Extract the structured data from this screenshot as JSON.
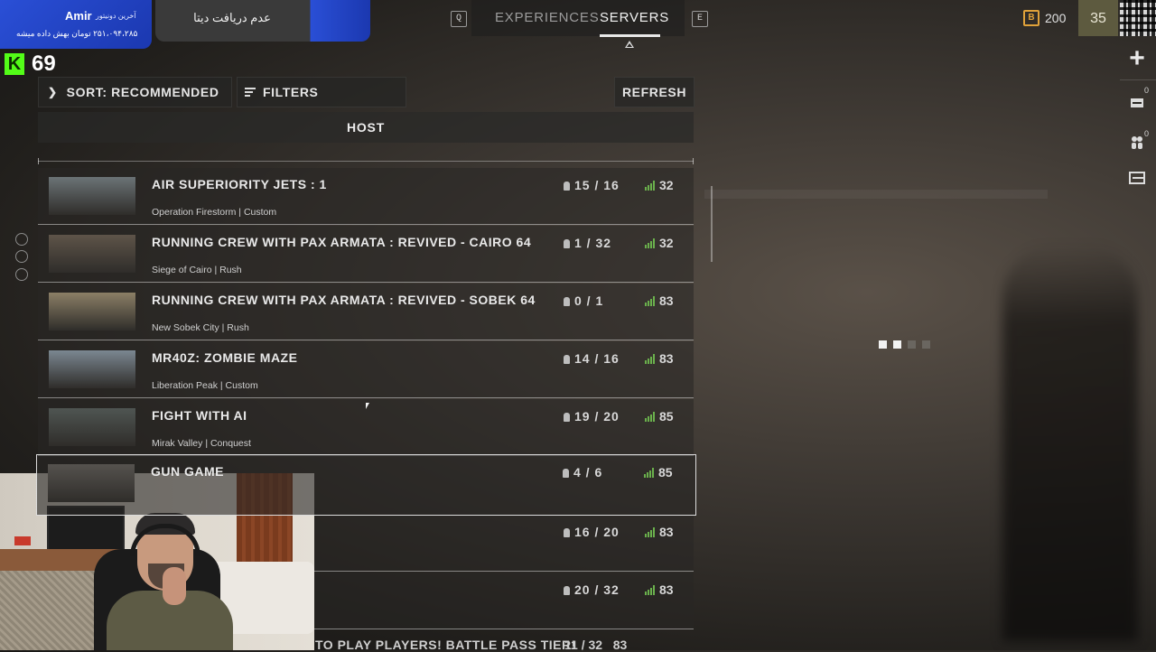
{
  "top_nav": {
    "key_left": "Q",
    "key_right": "E",
    "tabs": [
      {
        "label": "EXPERIENCES",
        "active": false
      },
      {
        "label": "SERVERS",
        "active": true
      }
    ],
    "currency_amount": "200",
    "player_level": "35"
  },
  "stream_overlay": {
    "donor_name": "Amir",
    "donor_caption": "آخرین دونیتور",
    "donation_text": "۲۵۱،۰۹۴،۲۸۵ تومان بهش داده میشه",
    "status_text": "عدم دریافت دیتا",
    "viewer_count": "69"
  },
  "side_panel": {
    "count_top": "0",
    "count_bottom": "0"
  },
  "toolbar": {
    "sort_label": "SORT: RECOMMENDED",
    "filters_label": "FILTERS",
    "refresh_label": "REFRESH"
  },
  "list_header": "HOST",
  "servers": [
    {
      "name": "AIR SUPERIORITY JETS : 1",
      "map": "Operation Firestorm",
      "mode": "Custom",
      "players": "15 / 16",
      "ping": "32",
      "thumb_color": "#6b7376"
    },
    {
      "name": "RUNNING CREW WITH PAX ARMATA : REVIVED - CAIRO 64",
      "map": "Siege of Cairo",
      "mode": "Rush",
      "players": "1 / 32",
      "ping": "32",
      "thumb_color": "#5e5449"
    },
    {
      "name": "RUNNING CREW WITH PAX ARMATA : REVIVED - SOBEK 64",
      "map": "New Sobek City",
      "mode": "Rush",
      "players": "0 / 1",
      "ping": "83",
      "thumb_color": "#8b7f66"
    },
    {
      "name": "MR40Z: ZOMBIE MAZE",
      "map": "Liberation Peak",
      "mode": "Custom",
      "players": "14 / 16",
      "ping": "83",
      "thumb_color": "#7b8791"
    },
    {
      "name": "FIGHT WITH AI",
      "map": "Mirak Valley",
      "mode": "Conquest",
      "players": "19 / 20",
      "ping": "85",
      "thumb_color": "#4f5552"
    },
    {
      "name": "GUN GAME",
      "map": "",
      "mode": "",
      "players": "4 / 6",
      "ping": "85",
      "thumb_color": "#55524e"
    },
    {
      "name": "",
      "map": "",
      "mode": "",
      "players": "16 / 20",
      "ping": "83",
      "thumb_color": "#4a4744"
    },
    {
      "name": "",
      "map": "",
      "mode": "",
      "players": "20 / 32",
      "ping": "83",
      "thumb_color": "#4a4744"
    }
  ],
  "partial_row": {
    "name": "TO PLAY PLAYERS! BATTLE PASS TIER!",
    "players": "11 / 32",
    "ping": "83"
  },
  "colors": {
    "accent_orange": "#e0a23a",
    "ping_green": "#6ab04c",
    "kick_green": "#53fc18",
    "stream_blue": "#2a4fd6"
  }
}
